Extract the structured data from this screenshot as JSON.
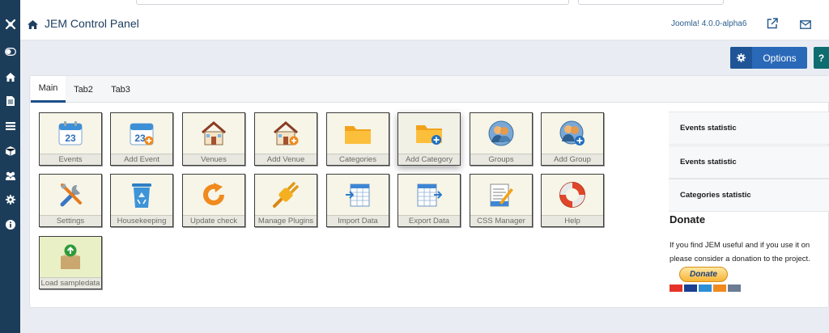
{
  "header": {
    "title": "JEM Control Panel",
    "version": "Joomla! 4.0.0-alpha6"
  },
  "toolbar": {
    "options_label": "Options",
    "help_label": "?"
  },
  "tabs": [
    {
      "label": "Main",
      "active": true
    },
    {
      "label": "Tab2",
      "active": false
    },
    {
      "label": "Tab3",
      "active": false
    }
  ],
  "tiles": [
    {
      "label": "Events",
      "icon": "calendar-icon"
    },
    {
      "label": "Add Event",
      "icon": "calendar-add-icon"
    },
    {
      "label": "Venues",
      "icon": "house-icon"
    },
    {
      "label": "Add Venue",
      "icon": "house-add-icon"
    },
    {
      "label": "Categories",
      "icon": "folder-icon"
    },
    {
      "label": "Add Category",
      "icon": "folder-add-icon"
    },
    {
      "label": "Groups",
      "icon": "user-group-icon"
    },
    {
      "label": "Add Group",
      "icon": "user-group-add-icon"
    },
    {
      "label": "Settings",
      "icon": "tools-icon"
    },
    {
      "label": "Housekeeping",
      "icon": "recycle-bin-icon"
    },
    {
      "label": "Update check",
      "icon": "refresh-icon"
    },
    {
      "label": "Manage Plugins",
      "icon": "plug-icon"
    },
    {
      "label": "Import Data",
      "icon": "spreadsheet-import-icon"
    },
    {
      "label": "Export Data",
      "icon": "spreadsheet-export-icon"
    },
    {
      "label": "CSS Manager",
      "icon": "css-edit-icon"
    },
    {
      "label": "Help",
      "icon": "lifebuoy-icon"
    },
    {
      "label": "Load sampledata",
      "icon": "box-upload-icon"
    }
  ],
  "stats": [
    {
      "label": "Events statistic"
    },
    {
      "label": "Events statistic"
    },
    {
      "label": "Categories statistic"
    }
  ],
  "donate": {
    "title": "Donate",
    "line1": "If you find JEM useful and if you use it on",
    "line2": "please consider a donation to the project.",
    "button": "Donate"
  },
  "colors": {
    "sidebar": "#1c3d5a",
    "primary": "#2a69b8",
    "help": "#0e6d6f",
    "active_tab": "#1d4e89"
  }
}
